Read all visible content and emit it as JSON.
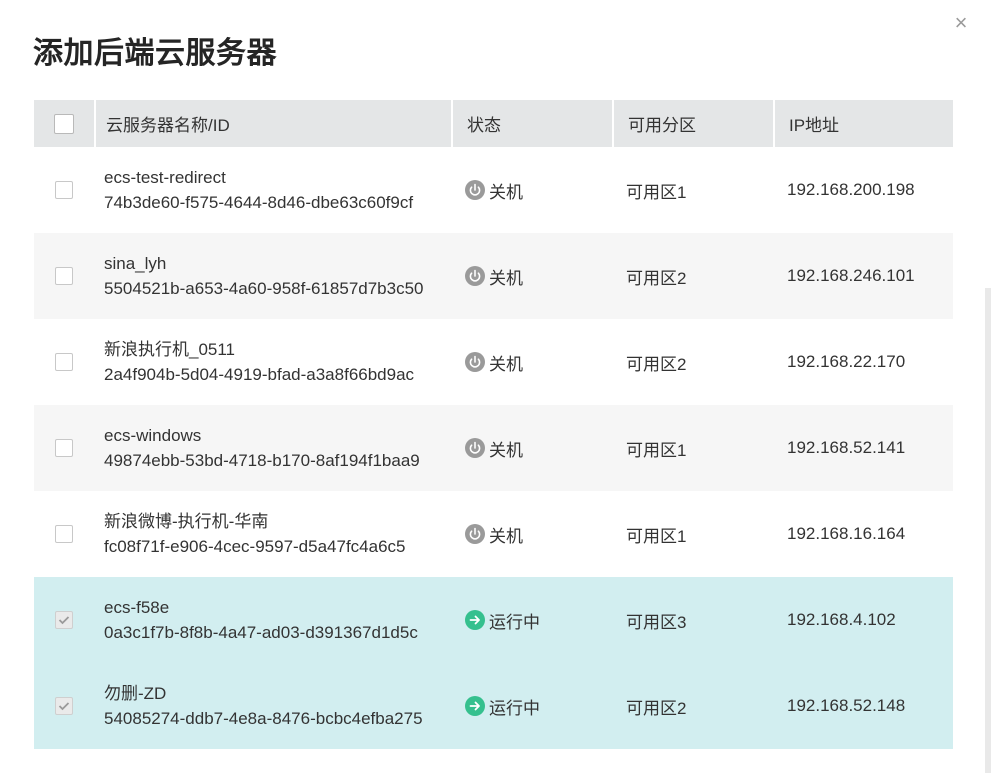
{
  "dialog": {
    "title": "添加后端云服务器",
    "close_glyph": "×"
  },
  "table": {
    "headers": {
      "name": "云服务器名称/ID",
      "status": "状态",
      "zone": "可用分区",
      "ip": "IP地址"
    },
    "rows": [
      {
        "name": "ecs-test-redirect",
        "id": "74b3de60-f575-4644-8d46-dbe63c60f9cf",
        "status": "关机",
        "status_icon": "power-icon",
        "zone": "可用区1",
        "ip": "192.168.200.198",
        "checked": false
      },
      {
        "name": "sina_lyh",
        "id": "5504521b-a653-4a60-958f-61857d7b3c50",
        "status": "关机",
        "status_icon": "power-icon",
        "zone": "可用区2",
        "ip": "192.168.246.101",
        "checked": false
      },
      {
        "name": "新浪执行机_0511",
        "id": "2a4f904b-5d04-4919-bfad-a3a8f66bd9ac",
        "status": "关机",
        "status_icon": "power-icon",
        "zone": "可用区2",
        "ip": "192.168.22.170",
        "checked": false
      },
      {
        "name": "ecs-windows",
        "id": "49874ebb-53bd-4718-b170-8af194f1baa9",
        "status": "关机",
        "status_icon": "power-icon",
        "zone": "可用区1",
        "ip": "192.168.52.141",
        "checked": false
      },
      {
        "name": "新浪微博-执行机-华南",
        "id": "fc08f71f-e906-4cec-9597-d5a47fc4a6c5",
        "status": "关机",
        "status_icon": "power-icon",
        "zone": "可用区1",
        "ip": "192.168.16.164",
        "checked": false
      },
      {
        "name": "ecs-f58e",
        "id": "0a3c1f7b-8f8b-4a47-ad03-d391367d1d5c",
        "status": "运行中",
        "status_icon": "running-arrow-icon",
        "zone": "可用区3",
        "ip": "192.168.4.102",
        "checked": true
      },
      {
        "name": "勿删-ZD",
        "id": "54085274-ddb7-4e8a-8476-bcbc4efba275",
        "status": "运行中",
        "status_icon": "running-arrow-icon",
        "zone": "可用区2",
        "ip": "192.168.52.148",
        "checked": true
      }
    ]
  },
  "colors": {
    "header_bg": "#e4e6e7",
    "selected_row_bg": "#d2eef0",
    "alt_row_bg": "#f6f6f6",
    "stopped_icon": "#9a9a9a",
    "running_icon": "#35c08e"
  }
}
